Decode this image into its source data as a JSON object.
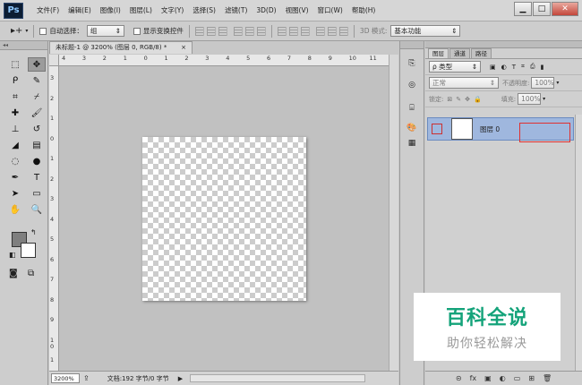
{
  "app": {
    "logo": "Ps"
  },
  "menu": [
    "文件(F)",
    "编辑(E)",
    "图像(I)",
    "图层(L)",
    "文字(Y)",
    "选择(S)",
    "滤镜(T)",
    "3D(D)",
    "视图(V)",
    "窗口(W)",
    "帮助(H)"
  ],
  "window_controls": {
    "minimize": "▁",
    "maximize": "□",
    "close": "✕"
  },
  "options": {
    "auto_select_label": "自动选择：",
    "auto_select_value": "组",
    "transform_label": "显示变换控件",
    "mode_3d": "3D 模式:",
    "workspace": "基本功能"
  },
  "toolbar": {
    "tools": [
      {
        "name": "marquee-tool-icon",
        "glyph": "⬚"
      },
      {
        "name": "move-tool-icon",
        "glyph": "✥"
      },
      {
        "name": "lasso-tool-icon",
        "glyph": "ᑭ"
      },
      {
        "name": "quick-select-tool-icon",
        "glyph": "✎"
      },
      {
        "name": "crop-tool-icon",
        "glyph": "⌗"
      },
      {
        "name": "eyedropper-tool-icon",
        "glyph": "⌿"
      },
      {
        "name": "healing-tool-icon",
        "glyph": "✚"
      },
      {
        "name": "brush-tool-icon",
        "glyph": "🖌"
      },
      {
        "name": "stamp-tool-icon",
        "glyph": "⊥"
      },
      {
        "name": "history-brush-tool-icon",
        "glyph": "↺"
      },
      {
        "name": "eraser-tool-icon",
        "glyph": "◢"
      },
      {
        "name": "gradient-tool-icon",
        "glyph": "▤"
      },
      {
        "name": "blur-tool-icon",
        "glyph": "◌"
      },
      {
        "name": "dodge-tool-icon",
        "glyph": "●"
      },
      {
        "name": "pen-tool-icon",
        "glyph": "✒"
      },
      {
        "name": "type-tool-icon",
        "glyph": "T"
      },
      {
        "name": "path-select-tool-icon",
        "glyph": "➤"
      },
      {
        "name": "shape-tool-icon",
        "glyph": "▭"
      },
      {
        "name": "hand-tool-icon",
        "glyph": "✋"
      },
      {
        "name": "zoom-tool-icon",
        "glyph": "🔍"
      }
    ],
    "colors": {
      "foreground": "#7f7f7f",
      "background": "#ffffff"
    }
  },
  "document": {
    "tab_title": "未标题-1 @ 3200% (图层 0, RGB/8) *",
    "tab_close": "×",
    "ruler_top_ticks": [
      "4",
      "3",
      "2",
      "1",
      "0",
      "1",
      "2",
      "3",
      "4",
      "5",
      "6",
      "7",
      "8",
      "9",
      "10",
      "11"
    ],
    "ruler_left_ticks": [
      "3",
      "2",
      "1",
      "0",
      "1",
      "2",
      "3",
      "4",
      "5",
      "6",
      "7",
      "8",
      "9",
      "1\n0",
      "1"
    ],
    "zoom": "3200%",
    "doc_info": "文档:192 字节/0 字节"
  },
  "layers_panel": {
    "tabs": [
      "图层",
      "通道",
      "路径"
    ],
    "filter_label": "ρ 类型",
    "blend_mode": "正常",
    "opacity_label": "不透明度:",
    "opacity_value": "100%",
    "lock_label": "锁定:",
    "fill_label": "填充:",
    "fill_value": "100%",
    "layer_name": "图层 0",
    "footer_icons": [
      "⊝",
      "fx",
      "▣",
      "◐",
      "▭",
      "⊞",
      "🗑"
    ]
  },
  "watermark": {
    "main": "百科全说",
    "sub": "助你轻松解决"
  }
}
